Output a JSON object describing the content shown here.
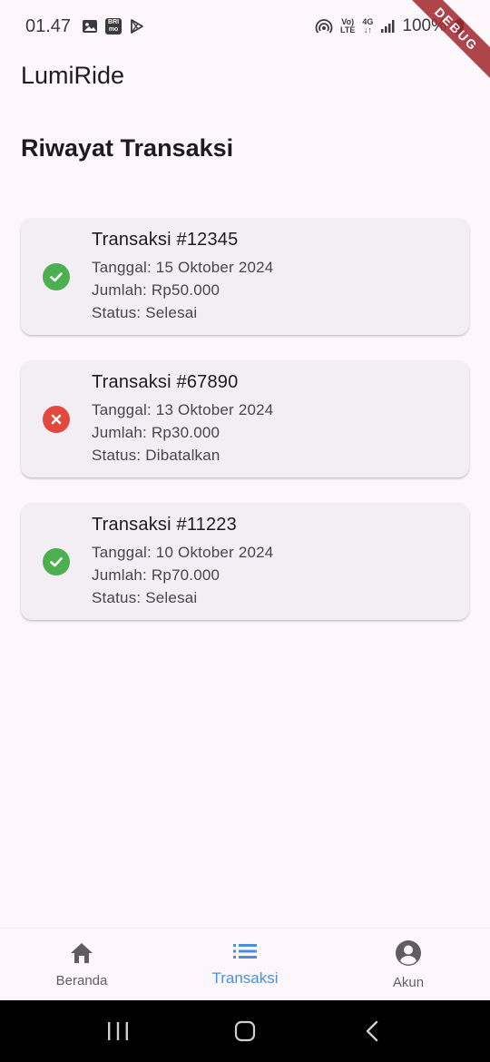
{
  "status_bar": {
    "time": "01.47",
    "battery": "100%",
    "network": "4G",
    "volte_top": "Vo)",
    "volte_bottom": "LTE",
    "bri_top": "BRI",
    "bri_bottom": "mo",
    "icons_left": [
      "image-icon",
      "bri-mo-icon",
      "play-store-icon"
    ],
    "icons_right": [
      "hotspot-icon",
      "volte-icon",
      "data-4g-icon",
      "signal-icon",
      "battery-icon"
    ]
  },
  "debug_banner": "DEBUG",
  "app": {
    "title": "LumiRide"
  },
  "page": {
    "title": "Riwayat Transaksi"
  },
  "transactions": [
    {
      "title": "Transaksi #12345",
      "date": "Tanggal: 15 Oktober 2024",
      "amount": "Jumlah: Rp50.000",
      "status": "Status: Selesai",
      "icon": "check-circle-icon",
      "color": "#4caf50"
    },
    {
      "title": "Transaksi #67890",
      "date": "Tanggal: 13 Oktober 2024",
      "amount": "Jumlah: Rp30.000",
      "status": "Status: Dibatalkan",
      "icon": "cancel-circle-icon",
      "color": "#e2483d"
    },
    {
      "title": "Transaksi #11223",
      "date": "Tanggal: 10 Oktober 2024",
      "amount": "Jumlah: Rp70.000",
      "status": "Status: Selesai",
      "icon": "check-circle-icon",
      "color": "#4caf50"
    }
  ],
  "bottom_nav": {
    "items": [
      {
        "label": "Beranda",
        "icon": "home-icon",
        "active": false
      },
      {
        "label": "Transaksi",
        "icon": "list-icon",
        "active": true
      },
      {
        "label": "Akun",
        "icon": "account-circle-icon",
        "active": false
      }
    ],
    "active_color": "#4a90d9"
  },
  "system_nav": {
    "buttons": [
      "recents-icon",
      "home-button-icon",
      "back-icon"
    ]
  }
}
